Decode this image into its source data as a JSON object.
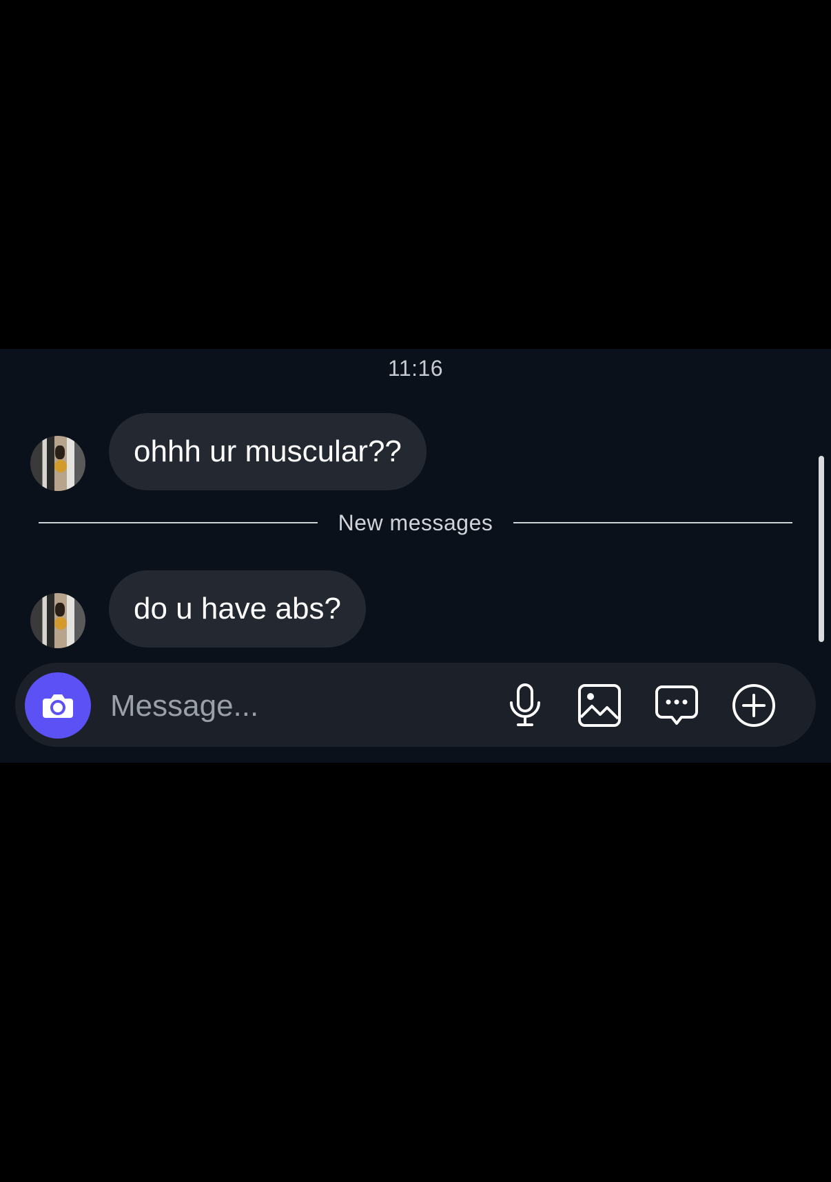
{
  "chat": {
    "timestamp": "11:16",
    "messages": [
      {
        "text": "ohhh ur muscular??"
      },
      {
        "text": "do u have abs?"
      }
    ],
    "divider_label": "New messages"
  },
  "composer": {
    "placeholder": "Message...",
    "value": ""
  },
  "icons": {
    "camera": "camera-icon",
    "mic": "microphone-icon",
    "gallery": "image-icon",
    "sticker": "chat-bubble-icon",
    "more": "plus-circle-icon"
  },
  "colors": {
    "panel_bg": "#0b111a",
    "bubble_bg": "#232831",
    "accent": "#5b51f5"
  }
}
